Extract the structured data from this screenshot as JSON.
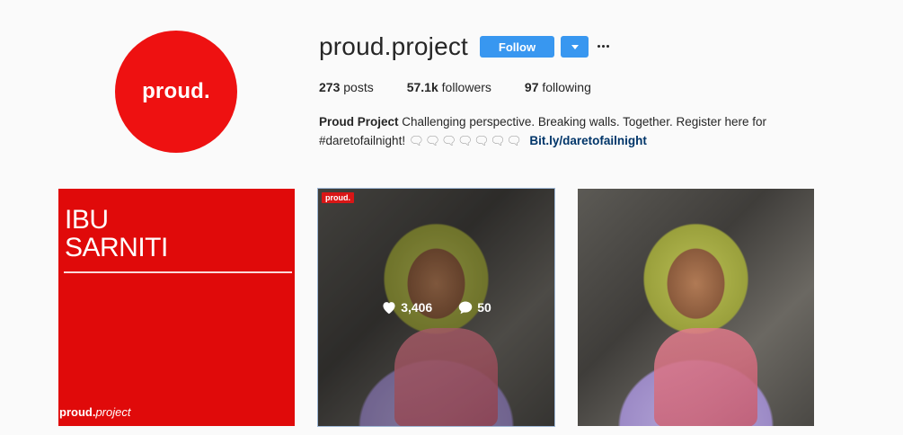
{
  "profile": {
    "avatar_text": "proud.",
    "username": "proud.project",
    "follow_label": "Follow"
  },
  "stats": {
    "posts_count": "273",
    "posts_label": " posts",
    "followers_count": "57.1k",
    "followers_label": " followers",
    "following_count": "97",
    "following_label": " following"
  },
  "bio": {
    "name": "Proud Project",
    "text": " Challenging perspective. Breaking walls. Together. Register here for #daretofailnight! ",
    "bubbles": "🗨🗨🗨🗨🗨🗨🗨",
    "link": "Bit.ly/daretofailnight"
  },
  "posts": [
    {
      "title_line1": "IBU",
      "title_line2": "SARNITI",
      "logo_bold": "proud.",
      "logo_italic": "project",
      "background": "#e00a0a"
    },
    {
      "tag": "proud.",
      "likes": "3,406",
      "comments": "50"
    },
    {}
  ],
  "colors": {
    "accent": "#3897f0",
    "brand_red": "#ee1111",
    "link": "#003569"
  },
  "icons": [
    "caret-down-icon",
    "more-icon",
    "heart-icon",
    "comment-icon"
  ]
}
